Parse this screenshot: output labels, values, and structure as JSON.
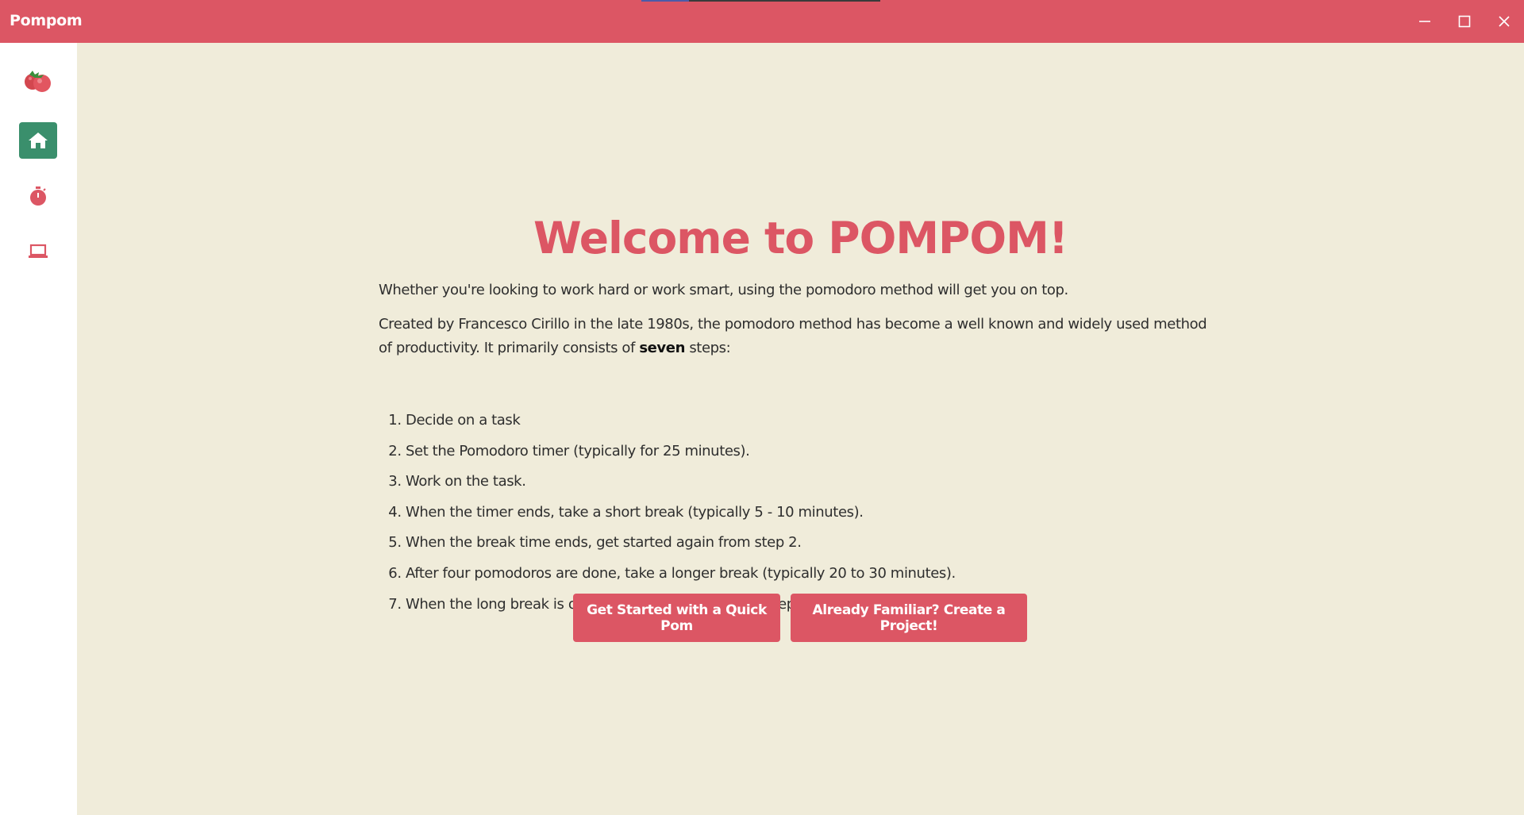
{
  "window": {
    "title": "Pompom",
    "controls": [
      "minimize-icon",
      "maximize-icon",
      "close-icon"
    ]
  },
  "sidebar": {
    "items": [
      {
        "name": "logo",
        "icon": "tomato-logo-icon",
        "active": false
      },
      {
        "name": "home",
        "icon": "home-icon",
        "active": true
      },
      {
        "name": "timer",
        "icon": "stopwatch-icon",
        "active": false
      },
      {
        "name": "projects",
        "icon": "laptop-icon",
        "active": false
      }
    ]
  },
  "main": {
    "title": "Welcome to POMPOM!",
    "intro": "Whether you're looking to work hard or work smart, using the pomodoro method will get you on top.",
    "description_before": "Created by Francesco Cirillo in the late 1980s, the pomodoro method has become a well known and widely used method of productivity. It primarily consists of ",
    "description_bold": "seven",
    "description_after": " steps:",
    "steps": [
      "Decide on a task",
      "Set the Pomodoro timer (typically for 25 minutes).",
      "Work on the task.",
      "When the timer ends, take a short break (typically 5 - 10 minutes).",
      "When the break time ends, get started again from step 2.",
      "After four pomodoros are done, take a longer break (typically 20 to 30 minutes).",
      "When the long break is over, get started again from step 2."
    ],
    "buttons": {
      "quick_pom": "Get Started with a Quick Pom",
      "create_project": "Already Familiar? Create a Project!"
    }
  },
  "colors": {
    "accent": "#dc5664",
    "active_nav": "#3a8f6c",
    "background": "#f0ecda",
    "sidebar": "#ffffff"
  }
}
